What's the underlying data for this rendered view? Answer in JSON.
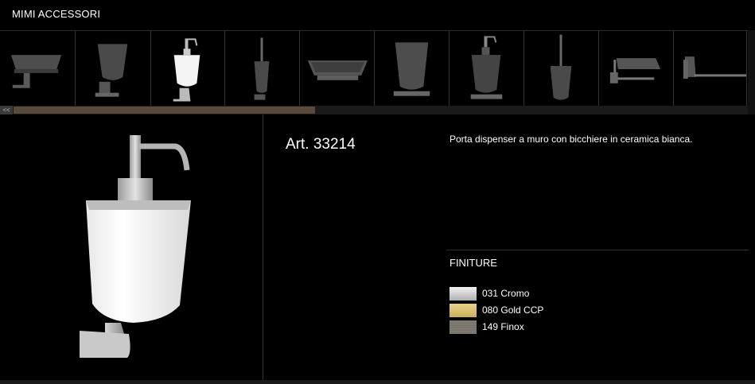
{
  "header": {
    "title": "MIMI ACCESSORI"
  },
  "thumbnails": [
    {
      "name": "soap-dish",
      "icon": "soap-dish-icon"
    },
    {
      "name": "tumbler-holder",
      "icon": "tumbler-icon"
    },
    {
      "name": "soap-dispenser-white",
      "icon": "dispenser-icon",
      "selected": true
    },
    {
      "name": "toilet-brush",
      "icon": "toilet-brush-icon"
    },
    {
      "name": "soap-dish-standing",
      "icon": "soap-dish-icon"
    },
    {
      "name": "tumbler-standing",
      "icon": "tumbler-icon"
    },
    {
      "name": "soap-dispenser-standing",
      "icon": "dispenser-icon"
    },
    {
      "name": "toilet-brush-standing",
      "icon": "toilet-brush-icon"
    },
    {
      "name": "toilet-roll-holder",
      "icon": "roll-holder-icon"
    },
    {
      "name": "towel-holder",
      "icon": "towel-holder-icon"
    }
  ],
  "scrollbar": {
    "left_label": "<<",
    "position": 0.0
  },
  "product": {
    "article": "Art. 33214",
    "description": "Porta dispenser a muro con bicchiere in ceramica bianca."
  },
  "finishes": {
    "title": "FINITURE",
    "items": [
      {
        "label": "031 Cromo",
        "color": "#d4d4d4"
      },
      {
        "label": "080 Gold CCP",
        "color": "#d8c173"
      },
      {
        "label": "149 Finox",
        "color": "#7a756d"
      }
    ]
  },
  "colors": {
    "background": "#000000",
    "scroll_thumb": "#5a4a3c",
    "divider": "#333333"
  }
}
